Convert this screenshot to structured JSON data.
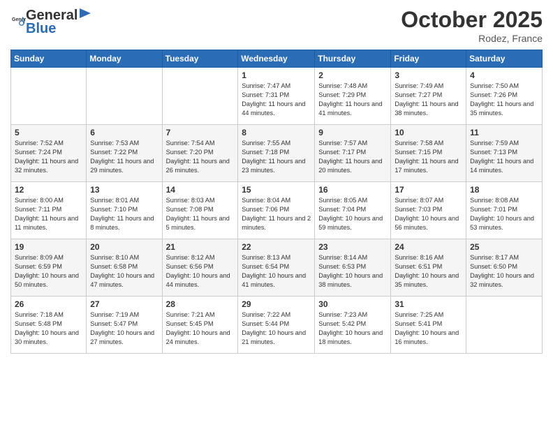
{
  "header": {
    "logo_general": "General",
    "logo_blue": "Blue",
    "month": "October 2025",
    "location": "Rodez, France"
  },
  "weekdays": [
    "Sunday",
    "Monday",
    "Tuesday",
    "Wednesday",
    "Thursday",
    "Friday",
    "Saturday"
  ],
  "weeks": [
    [
      {
        "day": "",
        "sunrise": "",
        "sunset": "",
        "daylight": ""
      },
      {
        "day": "",
        "sunrise": "",
        "sunset": "",
        "daylight": ""
      },
      {
        "day": "",
        "sunrise": "",
        "sunset": "",
        "daylight": ""
      },
      {
        "day": "1",
        "sunrise": "Sunrise: 7:47 AM",
        "sunset": "Sunset: 7:31 PM",
        "daylight": "Daylight: 11 hours and 44 minutes."
      },
      {
        "day": "2",
        "sunrise": "Sunrise: 7:48 AM",
        "sunset": "Sunset: 7:29 PM",
        "daylight": "Daylight: 11 hours and 41 minutes."
      },
      {
        "day": "3",
        "sunrise": "Sunrise: 7:49 AM",
        "sunset": "Sunset: 7:27 PM",
        "daylight": "Daylight: 11 hours and 38 minutes."
      },
      {
        "day": "4",
        "sunrise": "Sunrise: 7:50 AM",
        "sunset": "Sunset: 7:26 PM",
        "daylight": "Daylight: 11 hours and 35 minutes."
      }
    ],
    [
      {
        "day": "5",
        "sunrise": "Sunrise: 7:52 AM",
        "sunset": "Sunset: 7:24 PM",
        "daylight": "Daylight: 11 hours and 32 minutes."
      },
      {
        "day": "6",
        "sunrise": "Sunrise: 7:53 AM",
        "sunset": "Sunset: 7:22 PM",
        "daylight": "Daylight: 11 hours and 29 minutes."
      },
      {
        "day": "7",
        "sunrise": "Sunrise: 7:54 AM",
        "sunset": "Sunset: 7:20 PM",
        "daylight": "Daylight: 11 hours and 26 minutes."
      },
      {
        "day": "8",
        "sunrise": "Sunrise: 7:55 AM",
        "sunset": "Sunset: 7:18 PM",
        "daylight": "Daylight: 11 hours and 23 minutes."
      },
      {
        "day": "9",
        "sunrise": "Sunrise: 7:57 AM",
        "sunset": "Sunset: 7:17 PM",
        "daylight": "Daylight: 11 hours and 20 minutes."
      },
      {
        "day": "10",
        "sunrise": "Sunrise: 7:58 AM",
        "sunset": "Sunset: 7:15 PM",
        "daylight": "Daylight: 11 hours and 17 minutes."
      },
      {
        "day": "11",
        "sunrise": "Sunrise: 7:59 AM",
        "sunset": "Sunset: 7:13 PM",
        "daylight": "Daylight: 11 hours and 14 minutes."
      }
    ],
    [
      {
        "day": "12",
        "sunrise": "Sunrise: 8:00 AM",
        "sunset": "Sunset: 7:11 PM",
        "daylight": "Daylight: 11 hours and 11 minutes."
      },
      {
        "day": "13",
        "sunrise": "Sunrise: 8:01 AM",
        "sunset": "Sunset: 7:10 PM",
        "daylight": "Daylight: 11 hours and 8 minutes."
      },
      {
        "day": "14",
        "sunrise": "Sunrise: 8:03 AM",
        "sunset": "Sunset: 7:08 PM",
        "daylight": "Daylight: 11 hours and 5 minutes."
      },
      {
        "day": "15",
        "sunrise": "Sunrise: 8:04 AM",
        "sunset": "Sunset: 7:06 PM",
        "daylight": "Daylight: 11 hours and 2 minutes."
      },
      {
        "day": "16",
        "sunrise": "Sunrise: 8:05 AM",
        "sunset": "Sunset: 7:04 PM",
        "daylight": "Daylight: 10 hours and 59 minutes."
      },
      {
        "day": "17",
        "sunrise": "Sunrise: 8:07 AM",
        "sunset": "Sunset: 7:03 PM",
        "daylight": "Daylight: 10 hours and 56 minutes."
      },
      {
        "day": "18",
        "sunrise": "Sunrise: 8:08 AM",
        "sunset": "Sunset: 7:01 PM",
        "daylight": "Daylight: 10 hours and 53 minutes."
      }
    ],
    [
      {
        "day": "19",
        "sunrise": "Sunrise: 8:09 AM",
        "sunset": "Sunset: 6:59 PM",
        "daylight": "Daylight: 10 hours and 50 minutes."
      },
      {
        "day": "20",
        "sunrise": "Sunrise: 8:10 AM",
        "sunset": "Sunset: 6:58 PM",
        "daylight": "Daylight: 10 hours and 47 minutes."
      },
      {
        "day": "21",
        "sunrise": "Sunrise: 8:12 AM",
        "sunset": "Sunset: 6:56 PM",
        "daylight": "Daylight: 10 hours and 44 minutes."
      },
      {
        "day": "22",
        "sunrise": "Sunrise: 8:13 AM",
        "sunset": "Sunset: 6:54 PM",
        "daylight": "Daylight: 10 hours and 41 minutes."
      },
      {
        "day": "23",
        "sunrise": "Sunrise: 8:14 AM",
        "sunset": "Sunset: 6:53 PM",
        "daylight": "Daylight: 10 hours and 38 minutes."
      },
      {
        "day": "24",
        "sunrise": "Sunrise: 8:16 AM",
        "sunset": "Sunset: 6:51 PM",
        "daylight": "Daylight: 10 hours and 35 minutes."
      },
      {
        "day": "25",
        "sunrise": "Sunrise: 8:17 AM",
        "sunset": "Sunset: 6:50 PM",
        "daylight": "Daylight: 10 hours and 32 minutes."
      }
    ],
    [
      {
        "day": "26",
        "sunrise": "Sunrise: 7:18 AM",
        "sunset": "Sunset: 5:48 PM",
        "daylight": "Daylight: 10 hours and 30 minutes."
      },
      {
        "day": "27",
        "sunrise": "Sunrise: 7:19 AM",
        "sunset": "Sunset: 5:47 PM",
        "daylight": "Daylight: 10 hours and 27 minutes."
      },
      {
        "day": "28",
        "sunrise": "Sunrise: 7:21 AM",
        "sunset": "Sunset: 5:45 PM",
        "daylight": "Daylight: 10 hours and 24 minutes."
      },
      {
        "day": "29",
        "sunrise": "Sunrise: 7:22 AM",
        "sunset": "Sunset: 5:44 PM",
        "daylight": "Daylight: 10 hours and 21 minutes."
      },
      {
        "day": "30",
        "sunrise": "Sunrise: 7:23 AM",
        "sunset": "Sunset: 5:42 PM",
        "daylight": "Daylight: 10 hours and 18 minutes."
      },
      {
        "day": "31",
        "sunrise": "Sunrise: 7:25 AM",
        "sunset": "Sunset: 5:41 PM",
        "daylight": "Daylight: 10 hours and 16 minutes."
      },
      {
        "day": "",
        "sunrise": "",
        "sunset": "",
        "daylight": ""
      }
    ]
  ]
}
